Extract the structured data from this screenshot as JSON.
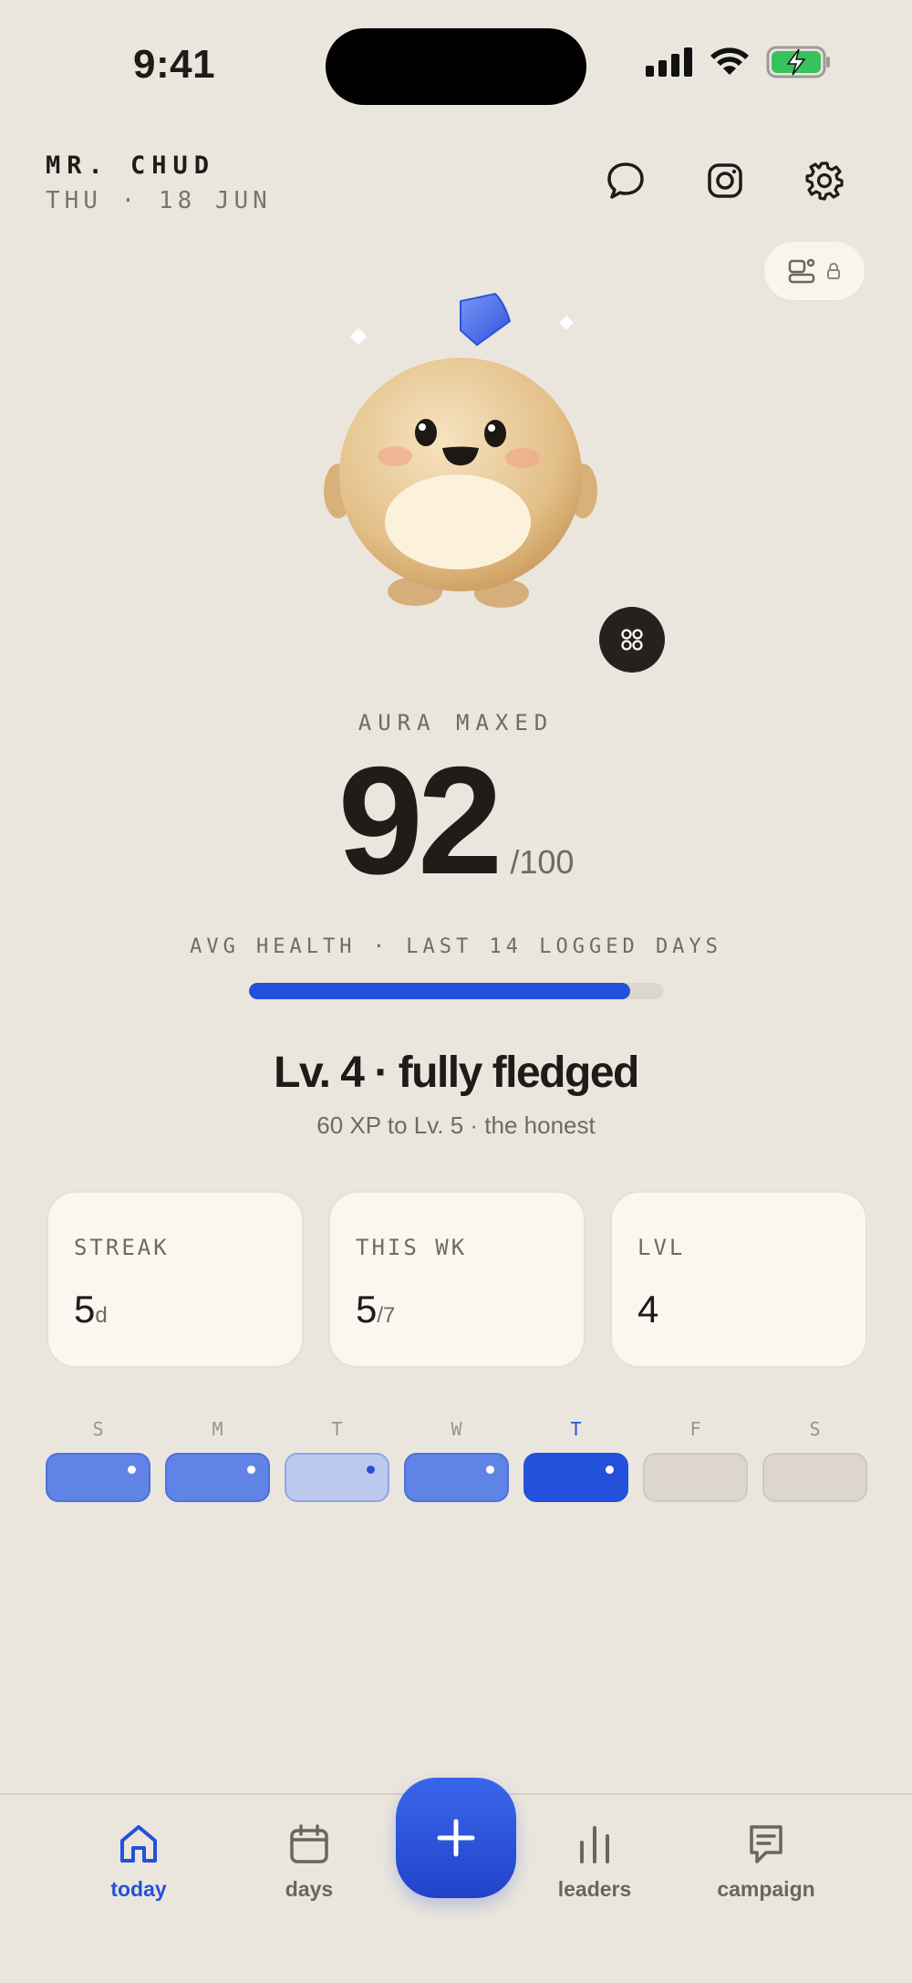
{
  "status_bar": {
    "time": "9:41"
  },
  "header": {
    "user_name": "MR. CHUD",
    "date": "THU · 18 JUN"
  },
  "score": {
    "label": "AURA MAXED",
    "value": "92",
    "max": "/100",
    "avg_label": "AVG HEALTH · LAST 14 LOGGED DAYS",
    "avg_fraction": 0.92
  },
  "level": {
    "title": "Lv. 4 · fully fledged",
    "subtitle": "60 XP to Lv. 5 · the honest"
  },
  "stats": [
    {
      "label": "STREAK",
      "value": "5",
      "unit": "d"
    },
    {
      "label": "THIS WK",
      "value": "5",
      "unit": "/7"
    },
    {
      "label": "LVL",
      "value": "4",
      "unit": ""
    }
  ],
  "week": [
    {
      "letter": "S",
      "state": "high",
      "dot": true
    },
    {
      "letter": "M",
      "state": "high",
      "dot": true
    },
    {
      "letter": "T",
      "state": "low",
      "dot": true
    },
    {
      "letter": "W",
      "state": "high",
      "dot": true
    },
    {
      "letter": "T",
      "state": "today",
      "dot": true
    },
    {
      "letter": "F",
      "state": "empty",
      "dot": false
    },
    {
      "letter": "S",
      "state": "empty",
      "dot": false
    }
  ],
  "tabs": {
    "today": "today",
    "days": "days",
    "leaders": "leaders",
    "campaign": "campaign"
  },
  "icons": {
    "chat": "chat-bubble-icon",
    "instagram": "instagram-icon",
    "settings": "gear-icon",
    "add": "plus-icon"
  },
  "colors": {
    "accent": "#2451dc",
    "background": "#ebe6dd",
    "card": "#faf7f0"
  }
}
